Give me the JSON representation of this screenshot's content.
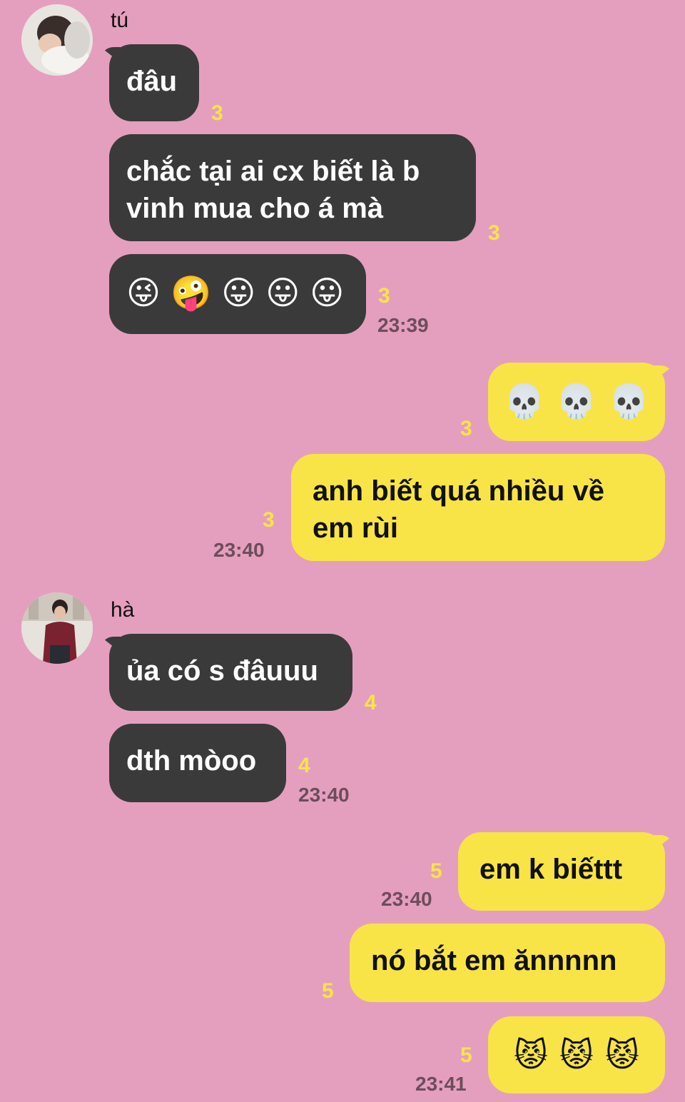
{
  "senders": {
    "first": "tú",
    "second": "hà"
  },
  "messages": {
    "m1": {
      "text": "đâu",
      "read": "3"
    },
    "m2": {
      "text": "chắc tại ai cx biết là b vinh mua cho á mà",
      "read": "3"
    },
    "m3": {
      "emojis": [
        "😜",
        "🤪",
        "😛",
        "😛",
        "😛"
      ],
      "read": "3",
      "time": "23:39"
    },
    "m4": {
      "emojis": [
        "💀",
        "💀",
        "💀"
      ],
      "read": "3"
    },
    "m5": {
      "text": "anh biết quá nhiều về em rùi",
      "read": "3",
      "time": "23:40"
    },
    "m6": {
      "text": "ủa có s đâuuu",
      "read": "4"
    },
    "m7": {
      "text": "dth mòoo",
      "read": "4",
      "time": "23:40"
    },
    "m8": {
      "text": "em k biếttt",
      "read": "5",
      "time": "23:40"
    },
    "m9": {
      "text": "nó bắt em ănnnnn",
      "read": "5"
    },
    "m10": {
      "emojis": [
        "😾",
        "😾",
        "😾"
      ],
      "read": "5",
      "time": "23:41"
    }
  },
  "colors": {
    "background": "#e49fbe",
    "incoming_bubble": "#3a3a3a",
    "outgoing_bubble": "#f8e447",
    "read_count": "#f8e447"
  }
}
